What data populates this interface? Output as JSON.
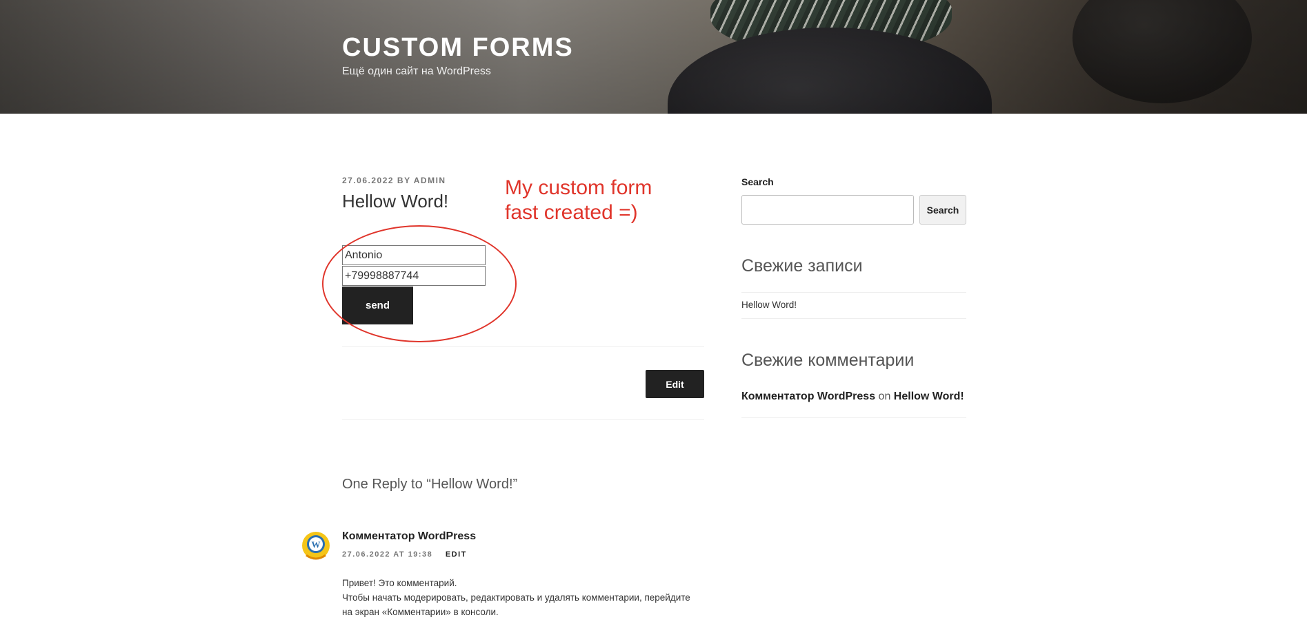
{
  "site": {
    "title": "CUSTOM FORMS",
    "description": "Ещё один сайт на WordPress"
  },
  "post": {
    "date": "27.06.2022",
    "by": "BY",
    "author": "ADMIN",
    "title": "Hellow Word!",
    "annotation_line1": "My custom form",
    "annotation_line2": "fast created =)",
    "form": {
      "name_value": "Antonio",
      "phone_value": "+79998887744",
      "send_label": "send"
    },
    "edit_label": "Edit"
  },
  "comments": {
    "title": "One Reply to “Hellow Word!”",
    "items": [
      {
        "author": "Комментатор WordPress",
        "date": "27.06.2022 AT 19:38",
        "edit": "EDIT",
        "line1": "Привет! Это комментарий.",
        "line2": "Чтобы начать модерировать, редактировать и удалять комментарии, перейдите",
        "line3": "на экран «Комментарии» в консоли."
      }
    ]
  },
  "sidebar": {
    "search": {
      "label": "Search",
      "button": "Search"
    },
    "recent_posts": {
      "title": "Свежие записи",
      "items": [
        "Hellow Word!"
      ]
    },
    "recent_comments": {
      "title": "Свежие комментарии",
      "author": "Комментатор WordPress",
      "on": "on",
      "post": "Hellow Word!"
    }
  },
  "colors": {
    "annotation": "#e0352b",
    "button": "#222222"
  }
}
